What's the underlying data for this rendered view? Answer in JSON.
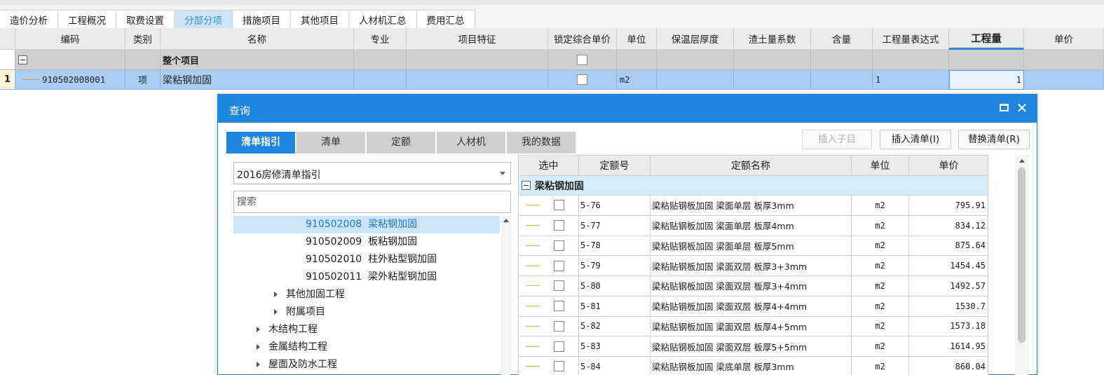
{
  "top_tabs": [
    {
      "label": "造价分析",
      "active": false
    },
    {
      "label": "工程概况",
      "active": false
    },
    {
      "label": "取费设置",
      "active": false
    },
    {
      "label": "分部分项",
      "active": true
    },
    {
      "label": "措施项目",
      "active": false
    },
    {
      "label": "其他项目",
      "active": false
    },
    {
      "label": "人材机汇总",
      "active": false
    },
    {
      "label": "费用汇总",
      "active": false
    }
  ],
  "grid": {
    "headers": [
      "编码",
      "类别",
      "名称",
      "专业",
      "项目特征",
      "锁定综合单价",
      "单位",
      "保温层厚度",
      "渣土量系数",
      "含量",
      "工程量表达式",
      "工程量",
      "单价"
    ],
    "active_header": "工程量",
    "group_row": {
      "label": "整个项目"
    },
    "item_row": {
      "index": "1",
      "code": "910502008001",
      "type": "项",
      "name": "梁粘钢加固",
      "unit": "m2",
      "expression": "1",
      "quantity": "1"
    }
  },
  "dialog": {
    "title": "查询",
    "tabs": [
      {
        "label": "清单指引",
        "active": true
      },
      {
        "label": "清单",
        "active": false
      },
      {
        "label": "定额",
        "active": false
      },
      {
        "label": "人材机",
        "active": false
      },
      {
        "label": "我的数据",
        "active": false
      }
    ],
    "buttons": {
      "insert_child": "插入子目",
      "insert_list": "插入清单(I)",
      "replace_list": "替换清单(R)"
    },
    "guide_select": "2016房修清单指引",
    "search_placeholder": "搜索",
    "tree": [
      {
        "label": "910502008  梁粘钢加固",
        "selected": true,
        "expandable": false
      },
      {
        "label": "910502009  板粘钢加固",
        "selected": false,
        "expandable": false
      },
      {
        "label": "910502010  柱外粘型钢加固",
        "selected": false,
        "expandable": false
      },
      {
        "label": "910502011  梁外粘型钢加固",
        "selected": false,
        "expandable": false
      },
      {
        "label": "其他加固工程",
        "selected": false,
        "expandable": true
      },
      {
        "label": "附属项目",
        "selected": false,
        "expandable": true
      },
      {
        "label": "木结构工程",
        "selected": false,
        "expandable": true
      },
      {
        "label": "金属结构工程",
        "selected": false,
        "expandable": true
      },
      {
        "label": "屋面及防水工程",
        "selected": false,
        "expandable": true
      }
    ],
    "quota_table": {
      "headers": [
        "选中",
        "定额号",
        "定额名称",
        "单位",
        "单价"
      ],
      "group": "梁粘钢加固",
      "rows": [
        {
          "code": "5-76",
          "name": "梁粘贴钢板加固 梁面单层 板厚3mm",
          "unit": "m2",
          "price": "795.91"
        },
        {
          "code": "5-77",
          "name": "梁粘贴钢板加固 梁面单层 板厚4mm",
          "unit": "m2",
          "price": "834.12"
        },
        {
          "code": "5-78",
          "name": "梁粘贴钢板加固 梁面单层 板厚5mm",
          "unit": "m2",
          "price": "875.64"
        },
        {
          "code": "5-79",
          "name": "梁粘贴钢板加固 梁面双层 板厚3+3mm",
          "unit": "m2",
          "price": "1454.45"
        },
        {
          "code": "5-80",
          "name": "梁粘贴钢板加固 梁面双层 板厚3+4mm",
          "unit": "m2",
          "price": "1492.57"
        },
        {
          "code": "5-81",
          "name": "梁粘贴钢板加固 梁面双层 板厚4+4mm",
          "unit": "m2",
          "price": "1530.7"
        },
        {
          "code": "5-82",
          "name": "梁粘贴钢板加固 梁面双层 板厚4+5mm",
          "unit": "m2",
          "price": "1573.18"
        },
        {
          "code": "5-83",
          "name": "梁粘贴钢板加固 梁面双层 板厚5+5mm",
          "unit": "m2",
          "price": "1614.95"
        },
        {
          "code": "5-84",
          "name": "梁粘贴钢板加固 梁底单层 板厚3mm",
          "unit": "m2",
          "price": "860.04"
        }
      ]
    }
  }
}
